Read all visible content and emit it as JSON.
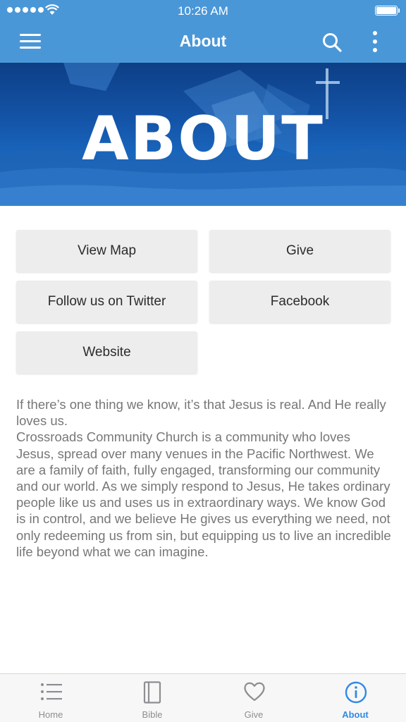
{
  "status_bar": {
    "time": "10:26 AM"
  },
  "nav": {
    "title": "About"
  },
  "banner": {
    "title": "ABOUT"
  },
  "buttons": {
    "view_map": "View Map",
    "give": "Give",
    "twitter": "Follow us on Twitter",
    "facebook": "Facebook",
    "website": "Website"
  },
  "description": {
    "line1": "If there’s one thing we know, it’s that Jesus is real. And He really loves us.",
    "line2": "Crossroads Community Church is a community who loves Jesus, spread over many venues in the Pacific Northwest. We are a family of faith, fully engaged, transforming our community and our world. As we simply respond to Jesus, He takes ordinary people like us and uses us in extraordinary ways. We know God is in control, and we believe He gives us everything we need, not only redeeming us from sin, but equipping us to live an incredible life beyond what we can imagine."
  },
  "tabs": [
    {
      "label": "Home",
      "icon": "list-icon"
    },
    {
      "label": "Bible",
      "icon": "book-icon"
    },
    {
      "label": "Give",
      "icon": "heart-icon"
    },
    {
      "label": "About",
      "icon": "info-icon"
    }
  ],
  "colors": {
    "header": "#4a97d8",
    "active_tab": "#2f8ae5",
    "inactive_tab": "#8e8e93",
    "button_bg": "#ededee",
    "body_text": "#777777"
  }
}
